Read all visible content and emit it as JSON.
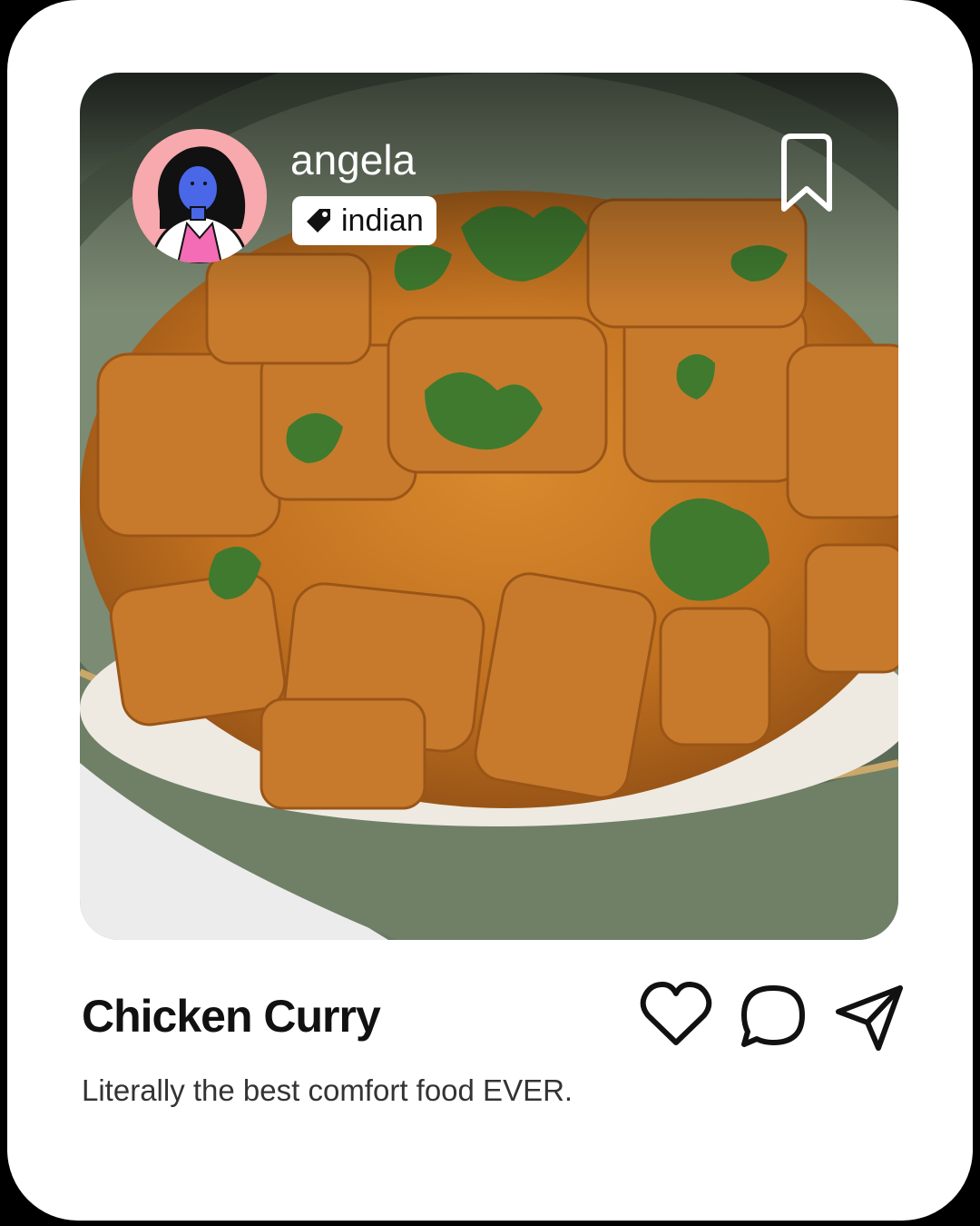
{
  "post": {
    "username": "angela",
    "tag": "indian",
    "title": "Chicken Curry",
    "caption": "Literally the best comfort food EVER."
  },
  "icons": {
    "tag": "tag-icon",
    "bookmark": "bookmark-icon",
    "like": "heart-icon",
    "comment": "comment-icon",
    "share": "send-icon"
  },
  "colors": {
    "avatar_bg": "#f7a9ad",
    "card_bg": "#ffffff",
    "text": "#111111"
  }
}
